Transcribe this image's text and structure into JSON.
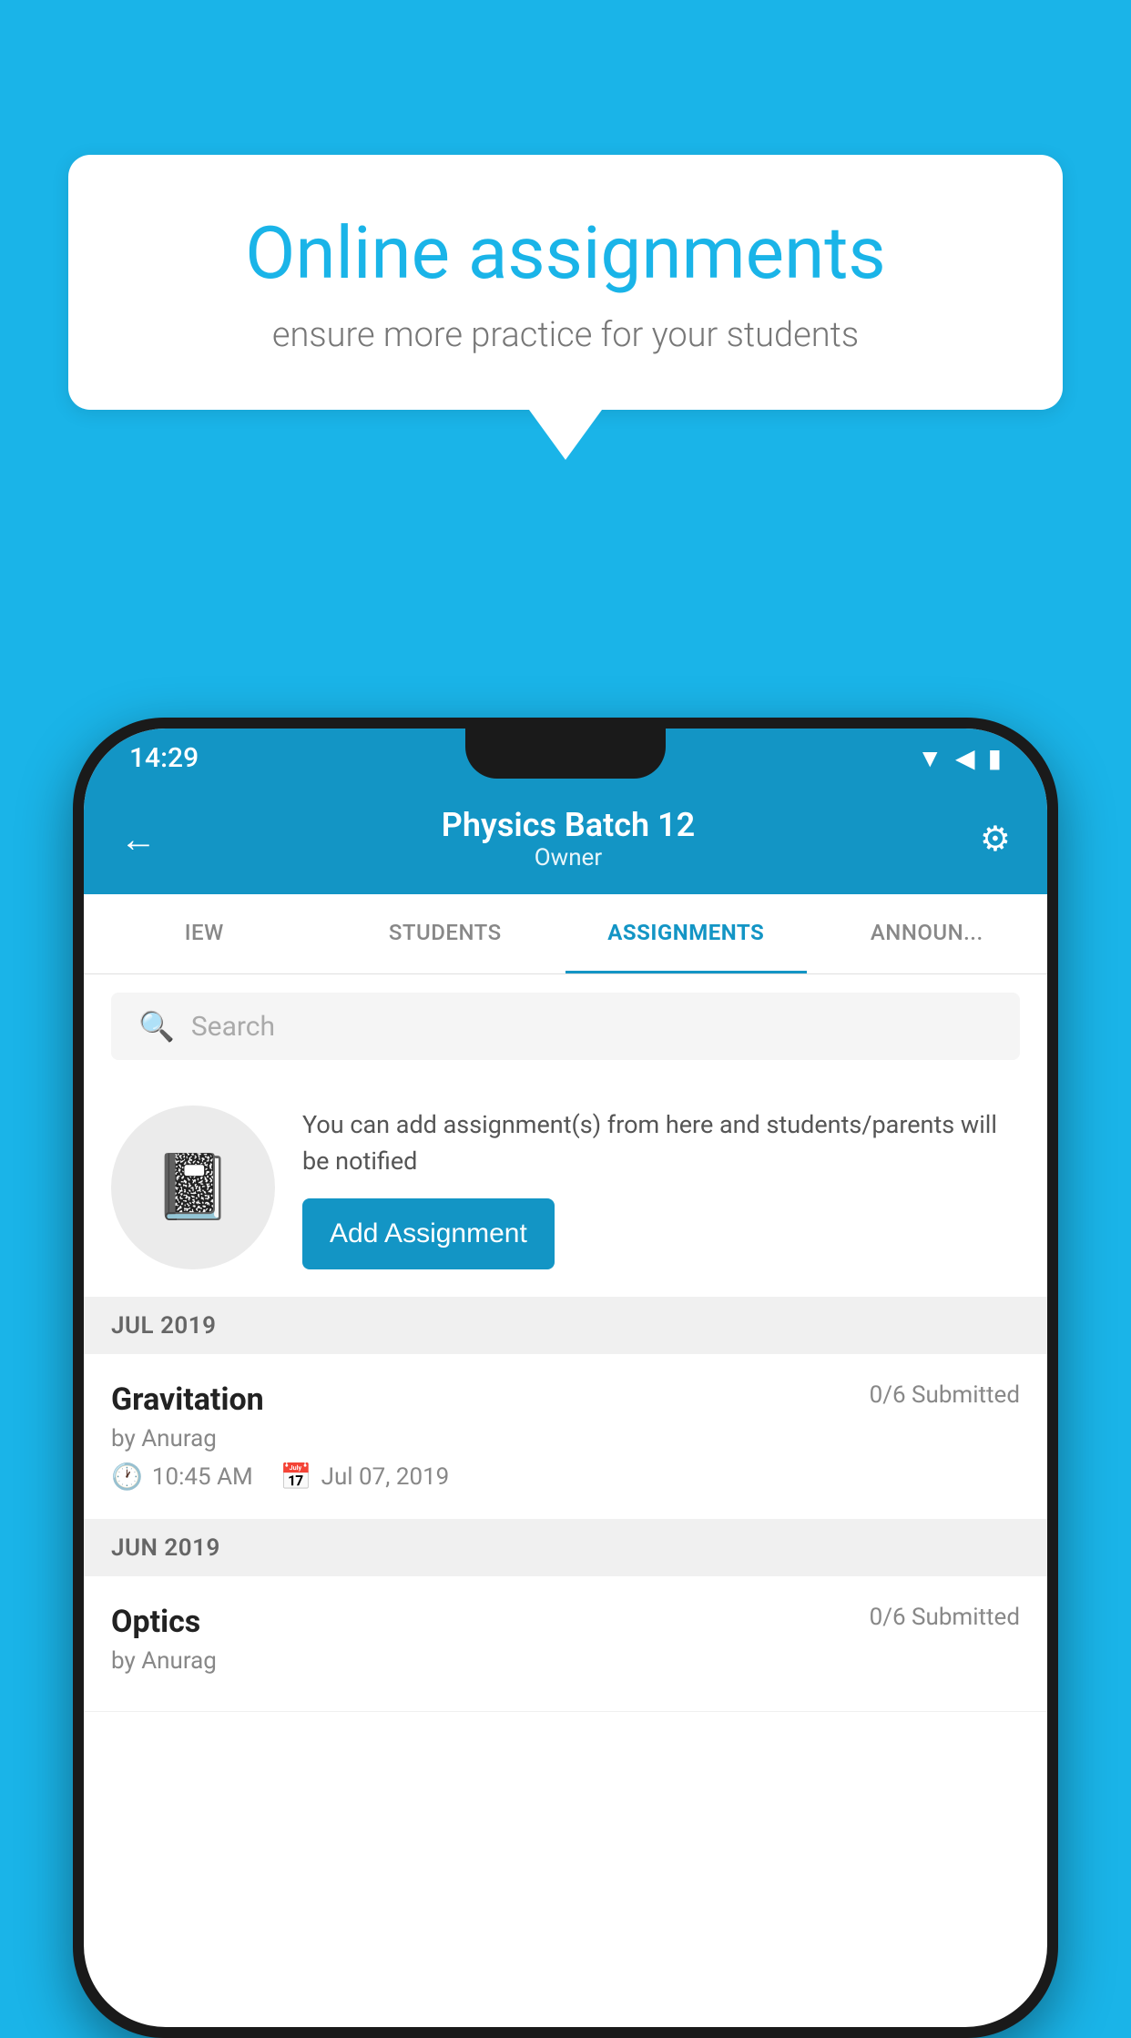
{
  "background_color": "#1ab4e8",
  "speech_bubble": {
    "title": "Online assignments",
    "subtitle": "ensure more practice for your students"
  },
  "phone": {
    "status_bar": {
      "time": "14:29",
      "wifi": "▲",
      "signal": "▲",
      "battery": "▪"
    },
    "header": {
      "title": "Physics Batch 12",
      "subtitle": "Owner",
      "back_label": "←",
      "settings_label": "⚙"
    },
    "tabs": [
      {
        "label": "IEW",
        "active": false
      },
      {
        "label": "STUDENTS",
        "active": false
      },
      {
        "label": "ASSIGNMENTS",
        "active": true
      },
      {
        "label": "ANNOUNCEMENTS",
        "active": false
      }
    ],
    "search": {
      "placeholder": "Search"
    },
    "promo": {
      "description": "You can add assignment(s) from here and students/parents will be notified",
      "button_label": "Add Assignment"
    },
    "sections": [
      {
        "month": "JUL 2019",
        "assignments": [
          {
            "title": "Gravitation",
            "submitted": "0/6 Submitted",
            "author": "by Anurag",
            "time": "10:45 AM",
            "date": "Jul 07, 2019"
          }
        ]
      },
      {
        "month": "JUN 2019",
        "assignments": [
          {
            "title": "Optics",
            "submitted": "0/6 Submitted",
            "author": "by Anurag",
            "time": "",
            "date": ""
          }
        ]
      }
    ]
  }
}
